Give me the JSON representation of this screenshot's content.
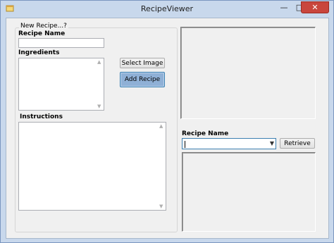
{
  "window": {
    "title": "RecipeViewer",
    "minimize_glyph": "—",
    "maximize_glyph": "□",
    "close_glyph": "✕"
  },
  "new_recipe": {
    "group_label": "New Recipe...?",
    "name_label": "Recipe Name",
    "name_value": "",
    "ingredients_label": "Ingredients",
    "ingredients_value": "",
    "instructions_label": "Instructions",
    "instructions_value": "",
    "select_image_button": "Select Image",
    "add_recipe_button": "Add Recipe"
  },
  "lookup": {
    "name_label": "Recipe Name",
    "selected_value": "",
    "retrieve_button": "Retrieve"
  },
  "icons": {
    "app": "app-window-icon",
    "scroll_up": "scroll-up-arrow",
    "scroll_down": "scroll-down-arrow",
    "dropdown": "chevron-down-icon"
  },
  "colors": {
    "title_bar": "#c8d8ec",
    "close_button": "#c9463d",
    "client_background": "#f0f0f0",
    "focused_border": "#3c7fb1",
    "primary_button": "#8fb0d6"
  }
}
